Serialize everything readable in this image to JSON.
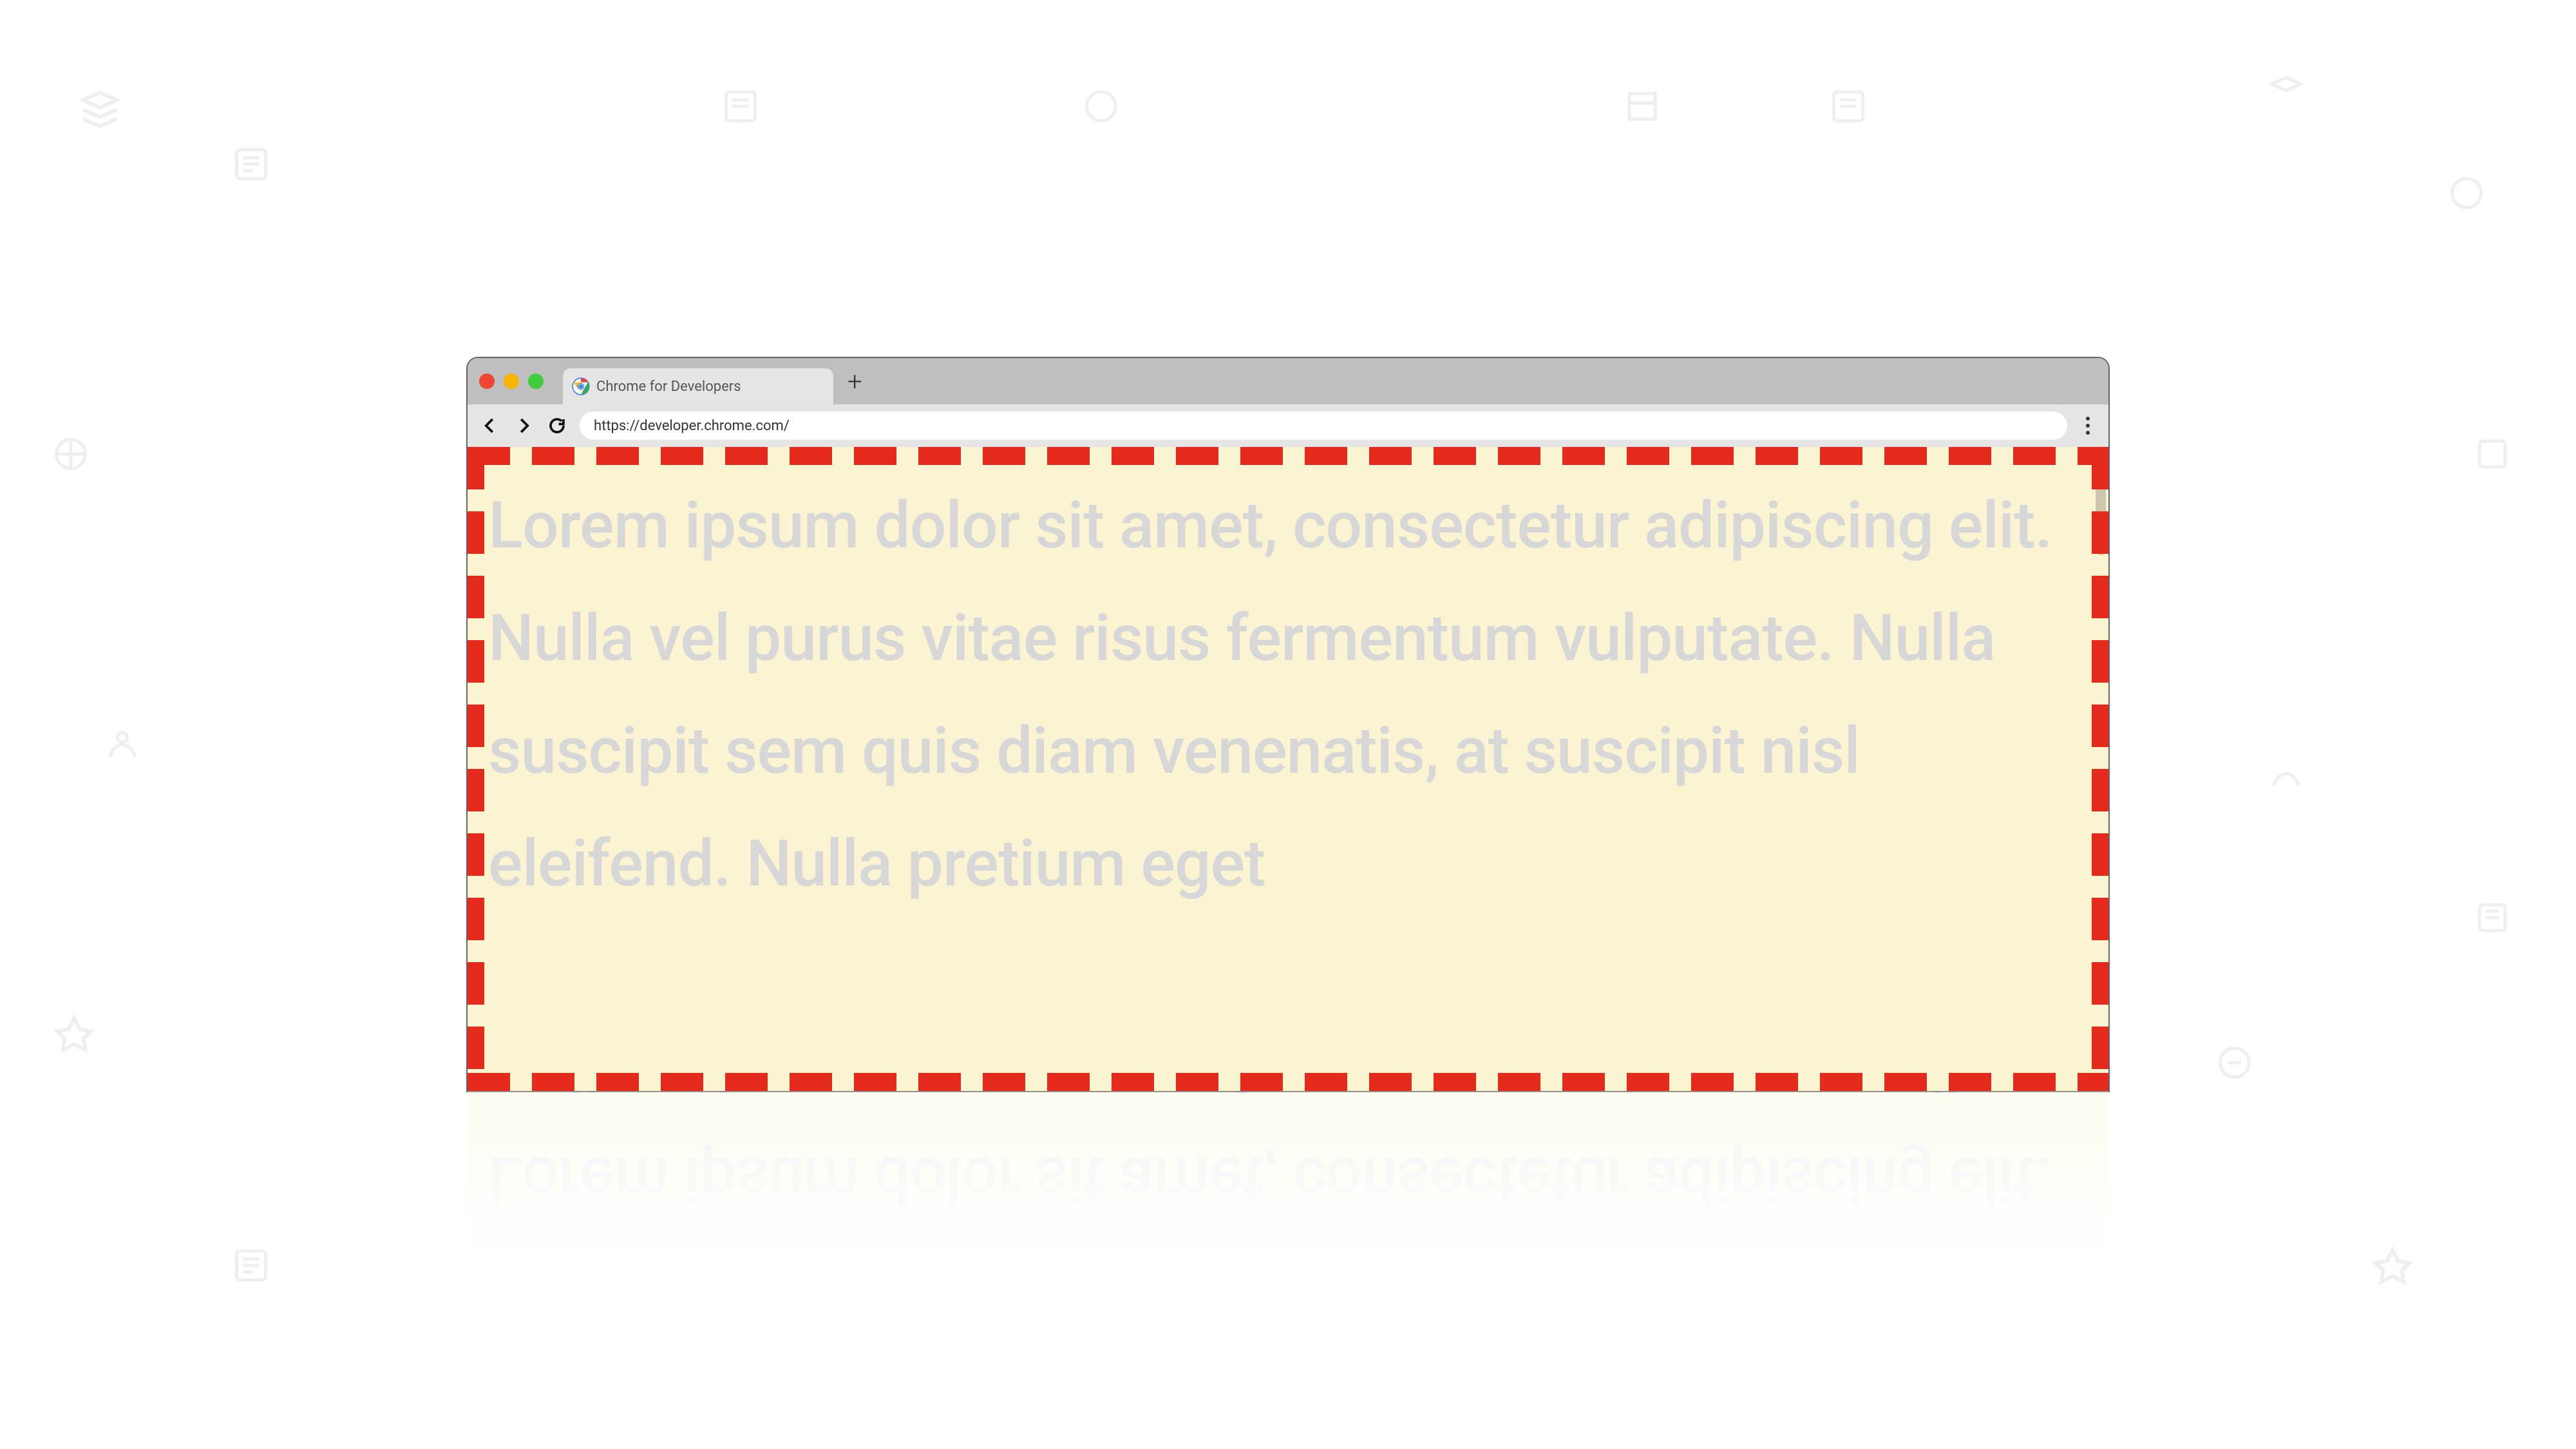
{
  "tab": {
    "title": "Chrome for Developers"
  },
  "toolbar": {
    "url": "https://developer.chrome.com/",
    "new_tab_glyph": "+"
  },
  "page": {
    "body_text": "Lorem ipsum dolor sit amet, consectetur adipiscing elit. Nulla vel purus vitae risus fermentum vulputate. Nulla suscipit sem quis diam venenatis, at suscipit nisl eleifend. Nulla pretium eget"
  },
  "colors": {
    "viewport_bg": "#fbf4d3",
    "dash": "#e42a1a",
    "text": "#d7d7d7"
  }
}
